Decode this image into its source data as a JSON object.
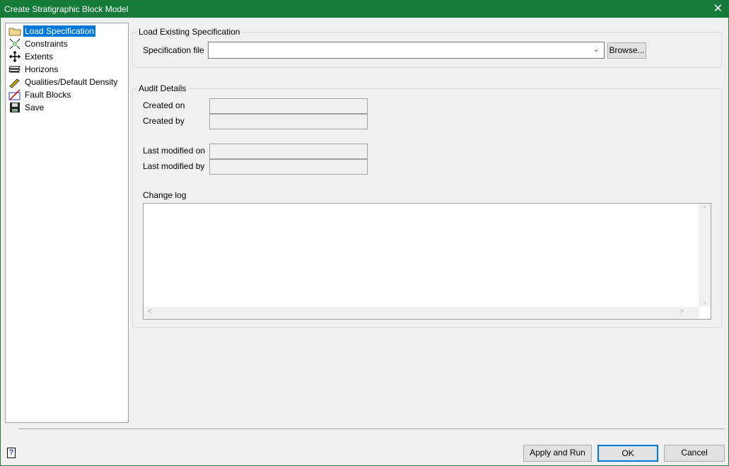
{
  "window": {
    "title": "Create Stratigraphic Block Model",
    "close": "✕"
  },
  "sidebar": {
    "items": [
      {
        "label": "Load Specification",
        "icon": "folder-icon"
      },
      {
        "label": "Constraints",
        "icon": "constraints-icon"
      },
      {
        "label": "Extents",
        "icon": "move-arrows-icon"
      },
      {
        "label": "Horizons",
        "icon": "layers-icon"
      },
      {
        "label": "Qualities/Default Density",
        "icon": "pencil-icon"
      },
      {
        "label": "Fault Blocks",
        "icon": "fault-icon"
      },
      {
        "label": "Save",
        "icon": "floppy-disk-icon"
      }
    ]
  },
  "load": {
    "group": "Load Existing Specification",
    "spec_label": "Specification file",
    "spec_value": "",
    "browse": "Browse..."
  },
  "audit": {
    "group": "Audit Details",
    "created_on": "Created on",
    "created_by": "Created by",
    "modified_on": "Last modified on",
    "modified_by": "Last modified by",
    "change_log": "Change log"
  },
  "footer": {
    "apply": "Apply and Run",
    "ok": "OK",
    "cancel": "Cancel",
    "help": "?"
  }
}
